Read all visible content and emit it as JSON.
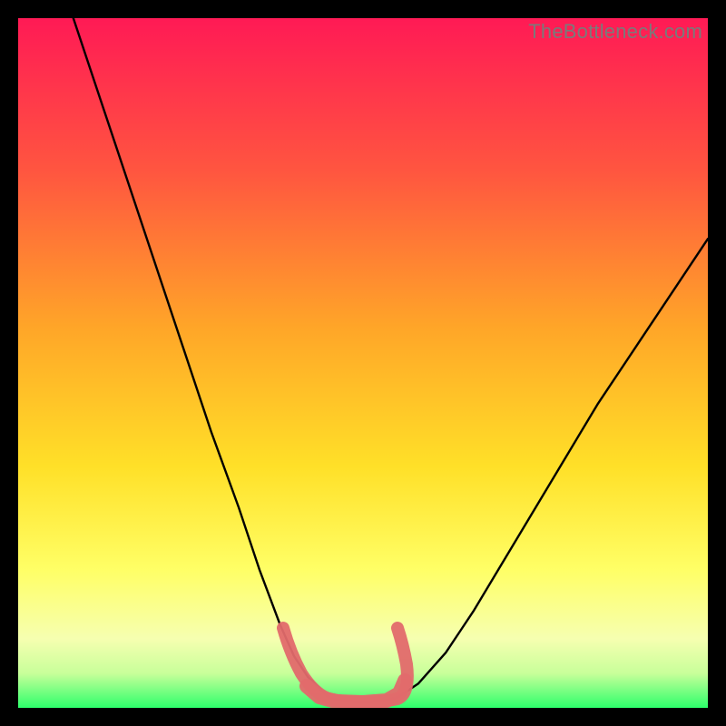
{
  "watermark": "TheBottleneck.com",
  "colors": {
    "bg": "#000000",
    "grad_top": "#ff1a55",
    "grad_mid1": "#ff7a2a",
    "grad_mid2": "#ffd21e",
    "grad_mid3": "#ffff66",
    "grad_bottom": "#2dff6b",
    "curve": "#000000",
    "pink_region": "#e16a6c"
  },
  "chart_data": {
    "type": "line",
    "title": "",
    "xlabel": "",
    "ylabel": "",
    "xlim": [
      0,
      100
    ],
    "ylim": [
      0,
      100
    ],
    "series": [
      {
        "name": "left-branch",
        "x": [
          8,
          12,
          16,
          20,
          24,
          28,
          32,
          35,
          38,
          40,
          42,
          44,
          45
        ],
        "y": [
          100,
          88,
          76,
          64,
          52,
          40,
          29,
          20,
          12,
          7.5,
          4.5,
          2.5,
          1.5
        ]
      },
      {
        "name": "bottom-flat",
        "x": [
          45,
          47,
          49,
          51,
          53,
          55
        ],
        "y": [
          1.5,
          1.0,
          0.9,
          0.9,
          1.0,
          1.5
        ]
      },
      {
        "name": "right-branch",
        "x": [
          55,
          58,
          62,
          66,
          72,
          78,
          84,
          90,
          96,
          100
        ],
        "y": [
          1.5,
          3.5,
          8,
          14,
          24,
          34,
          44,
          53,
          62,
          68
        ]
      }
    ],
    "highlight": {
      "name": "pink-trough-band",
      "xrange": [
        38,
        56
      ],
      "yrange": [
        0,
        12
      ]
    },
    "grid": false,
    "legend": false
  }
}
